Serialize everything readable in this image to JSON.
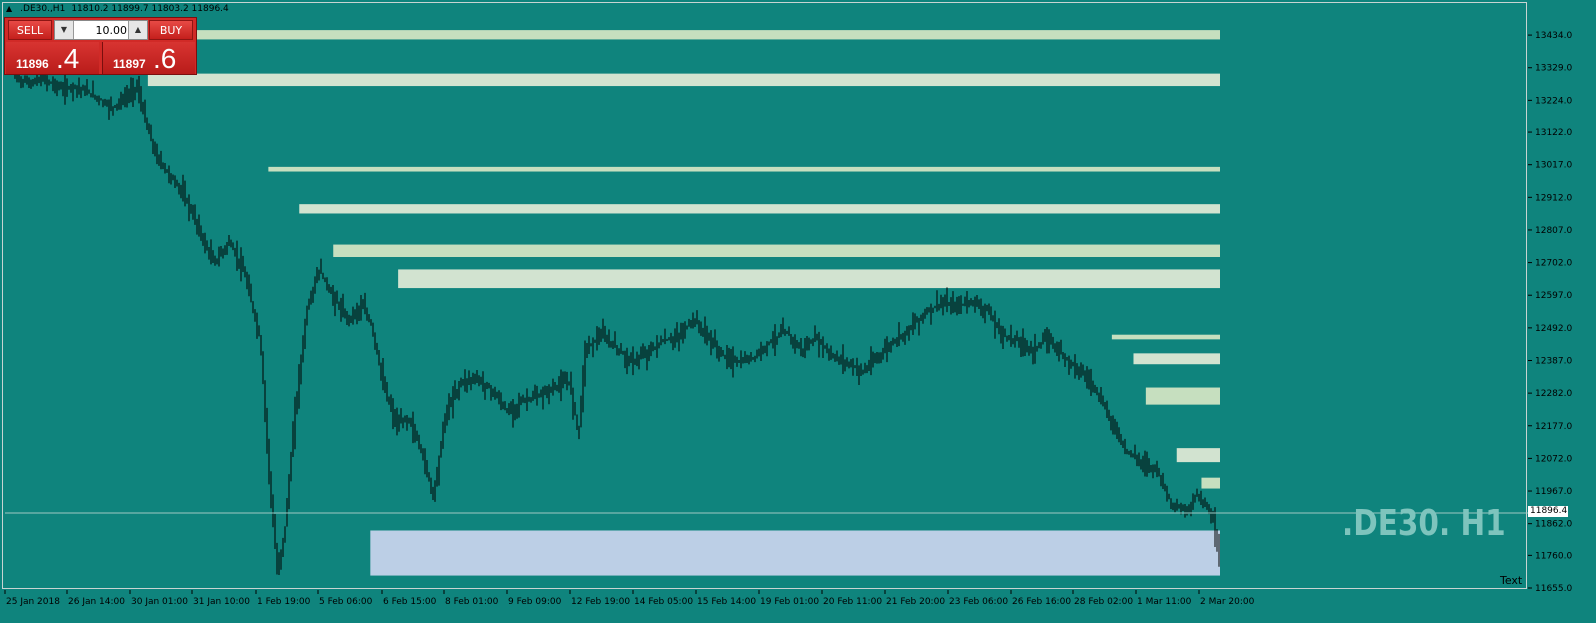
{
  "window": {
    "symbol_caption": ".DE30.,H1",
    "ohlc_values": "11810.2 11899.7 11803.2 11896.4"
  },
  "trade_panel": {
    "sell_label": "SELL",
    "buy_label": "BUY",
    "lot_value": "10.00",
    "bid_main": "11896",
    "bid_tail": ".4",
    "ask_main": "11897",
    "ask_tail": ".6"
  },
  "watermark": ".DE30. H1",
  "text_object_label": "Text",
  "current_price_label": "11896.4",
  "colors": {
    "background": "#0f847d",
    "candles": "#000000",
    "supply_zone": "#c6dfbf",
    "supply_zone_alt": "#d2e3d0",
    "demand_zone": "#bccfe6",
    "sell_button": "#d12a27",
    "watermark": "#7ec4bd"
  },
  "chart_data": {
    "type": "candlestick",
    "symbol": ".DE30.",
    "timeframe": "H1",
    "y_ticks": [
      "13434.0",
      "13329.0",
      "13224.0",
      "13122.0",
      "13017.0",
      "12912.0",
      "12807.0",
      "12702.0",
      "12597.0",
      "12492.0",
      "12387.0",
      "12282.0",
      "12177.0",
      "12072.0",
      "11967.0",
      "11862.0",
      "11760.0",
      "11655.0"
    ],
    "ylim": [
      11630,
      13470
    ],
    "x_ticks": [
      "25 Jan 2018",
      "26 Jan 14:00",
      "30 Jan 01:00",
      "31 Jan 10:00",
      "1 Feb 19:00",
      "5 Feb 06:00",
      "6 Feb 15:00",
      "8 Feb 01:00",
      "9 Feb 09:00",
      "12 Feb 19:00",
      "14 Feb 05:00",
      "15 Feb 14:00",
      "19 Feb 01:00",
      "20 Feb 11:00",
      "21 Feb 20:00",
      "23 Feb 06:00",
      "26 Feb 16:00",
      "28 Feb 02:00",
      "1 Mar 11:00",
      "2 Mar 20:00"
    ],
    "price_path": [
      [
        0,
        13300
      ],
      [
        0.5,
        13280
      ],
      [
        1,
        13290
      ],
      [
        1.6,
        13260
      ],
      [
        2,
        13270
      ],
      [
        2.6,
        13240
      ],
      [
        3.2,
        13200
      ],
      [
        3.6,
        13230
      ],
      [
        4,
        13270
      ],
      [
        4.3,
        13150
      ],
      [
        4.6,
        13050
      ],
      [
        5,
        12990
      ],
      [
        5.4,
        12940
      ],
      [
        5.8,
        12860
      ],
      [
        6.2,
        12760
      ],
      [
        6.5,
        12700
      ],
      [
        7,
        12770
      ],
      [
        7.5,
        12660
      ],
      [
        8,
        12450
      ],
      [
        8.3,
        12000
      ],
      [
        8.55,
        11700
      ],
      [
        8.8,
        11850
      ],
      [
        9.1,
        12200
      ],
      [
        9.5,
        12550
      ],
      [
        9.9,
        12680
      ],
      [
        10.3,
        12600
      ],
      [
        10.8,
        12520
      ],
      [
        11.3,
        12560
      ],
      [
        11.6,
        12500
      ],
      [
        12,
        12300
      ],
      [
        12.4,
        12180
      ],
      [
        12.8,
        12200
      ],
      [
        13.2,
        12100
      ],
      [
        13.6,
        11950
      ],
      [
        14,
        12220
      ],
      [
        14.5,
        12320
      ],
      [
        15,
        12330
      ],
      [
        15.5,
        12290
      ],
      [
        16,
        12220
      ],
      [
        16.5,
        12260
      ],
      [
        17,
        12270
      ],
      [
        17.5,
        12300
      ],
      [
        18,
        12320
      ],
      [
        18.3,
        12150
      ],
      [
        18.5,
        12420
      ],
      [
        19,
        12470
      ],
      [
        19.5,
        12430
      ],
      [
        20,
        12380
      ],
      [
        20.5,
        12410
      ],
      [
        21,
        12450
      ],
      [
        21.5,
        12460
      ],
      [
        22,
        12520
      ],
      [
        22.5,
        12460
      ],
      [
        23,
        12400
      ],
      [
        23.5,
        12380
      ],
      [
        24,
        12400
      ],
      [
        24.5,
        12450
      ],
      [
        25,
        12480
      ],
      [
        25.5,
        12420
      ],
      [
        26,
        12460
      ],
      [
        26.5,
        12400
      ],
      [
        27,
        12380
      ],
      [
        27.5,
        12350
      ],
      [
        28,
        12400
      ],
      [
        28.5,
        12450
      ],
      [
        29,
        12490
      ],
      [
        29.5,
        12540
      ],
      [
        30,
        12570
      ],
      [
        30.5,
        12560
      ],
      [
        31,
        12580
      ],
      [
        31.5,
        12550
      ],
      [
        32,
        12470
      ],
      [
        32.5,
        12450
      ],
      [
        33,
        12420
      ],
      [
        33.5,
        12460
      ],
      [
        34,
        12400
      ],
      [
        34.5,
        12360
      ],
      [
        35,
        12300
      ],
      [
        35.5,
        12200
      ],
      [
        36,
        12100
      ],
      [
        36.5,
        12060
      ],
      [
        37,
        12040
      ],
      [
        37.5,
        11920
      ],
      [
        38,
        11900
      ],
      [
        38.3,
        11960
      ],
      [
        38.6,
        11920
      ],
      [
        38.8,
        11900
      ],
      [
        39,
        11760
      ]
    ],
    "x_max": 39,
    "zones": [
      {
        "kind": "supply",
        "top": 13450,
        "bottom": 13420,
        "x_start": 4.3,
        "x_end": 39
      },
      {
        "kind": "supply",
        "top": 13310,
        "bottom": 13270,
        "x_start": 4.3,
        "x_end": 39
      },
      {
        "kind": "supply",
        "top": 13010,
        "bottom": 12995,
        "x_start": 8.2,
        "x_end": 39
      },
      {
        "kind": "supply",
        "top": 12890,
        "bottom": 12860,
        "x_start": 9.2,
        "x_end": 39
      },
      {
        "kind": "supply",
        "top": 12760,
        "bottom": 12720,
        "x_start": 10.3,
        "x_end": 39
      },
      {
        "kind": "supply",
        "top": 12680,
        "bottom": 12620,
        "x_start": 12.4,
        "x_end": 39
      },
      {
        "kind": "supply",
        "top": 12470,
        "bottom": 12455,
        "x_start": 35.5,
        "x_end": 39
      },
      {
        "kind": "supply",
        "top": 12410,
        "bottom": 12375,
        "x_start": 36.2,
        "x_end": 39
      },
      {
        "kind": "supply",
        "top": 12300,
        "bottom": 12245,
        "x_start": 36.6,
        "x_end": 39
      },
      {
        "kind": "supply",
        "top": 12105,
        "bottom": 12060,
        "x_start": 37.6,
        "x_end": 39
      },
      {
        "kind": "supply",
        "top": 12010,
        "bottom": 11975,
        "x_start": 38.4,
        "x_end": 39
      },
      {
        "kind": "demand",
        "top": 11840,
        "bottom": 11695,
        "x_start": 11.5,
        "x_end": 39
      }
    ],
    "current_price": 11896.4
  }
}
